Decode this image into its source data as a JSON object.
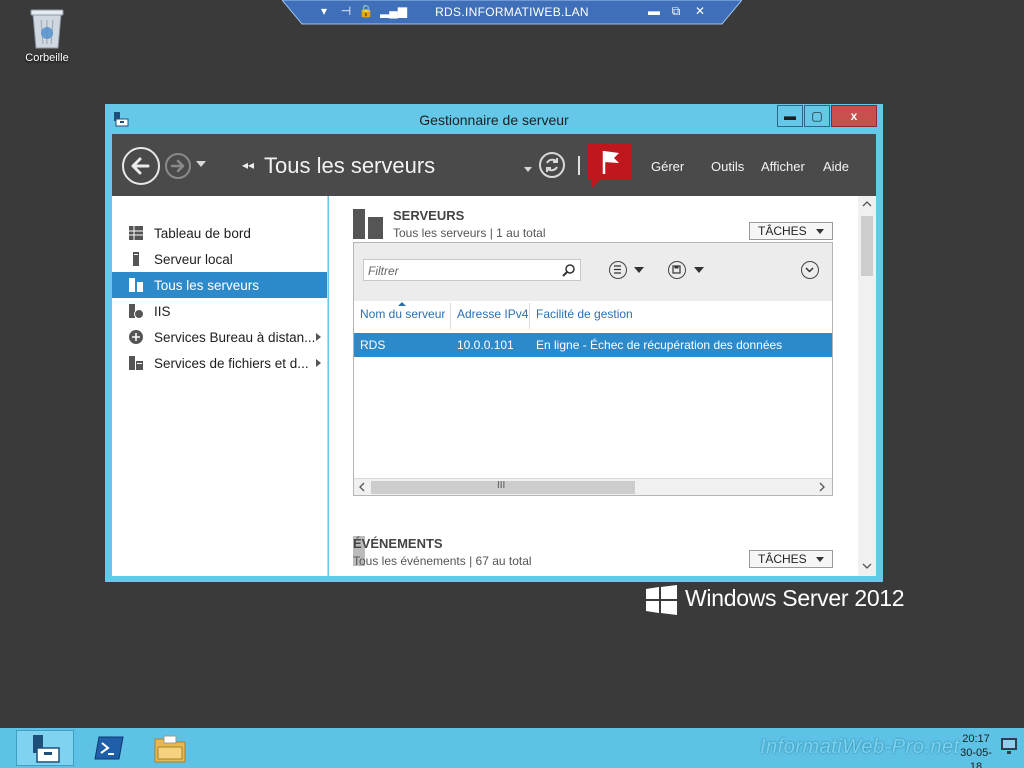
{
  "rdp_bar": {
    "title": "RDS.INFORMATIWEB.LAN"
  },
  "desktop": {
    "recycle_bin_label": "Corbeille"
  },
  "window": {
    "title": "Gestionnaire de serveur",
    "min_label": "▬",
    "max_label": "▢",
    "close_label": "x"
  },
  "toolbar": {
    "crumb_arrows": "◂◂",
    "breadcrumb": "Tous les serveurs",
    "menu": [
      "Gérer",
      "Outils",
      "Afficher",
      "Aide"
    ]
  },
  "nav": {
    "items": [
      {
        "label": "Tableau de bord",
        "icon": "dashboard-icon",
        "selected": false,
        "expandable": false
      },
      {
        "label": "Serveur local",
        "icon": "local-server-icon",
        "selected": false,
        "expandable": false
      },
      {
        "label": "Tous les serveurs",
        "icon": "all-servers-icon",
        "selected": true,
        "expandable": false
      },
      {
        "label": "IIS",
        "icon": "iis-icon",
        "selected": false,
        "expandable": false
      },
      {
        "label": "Services Bureau à distan...",
        "icon": "remote-desktop-icon",
        "selected": false,
        "expandable": true
      },
      {
        "label": "Services de fichiers et d...",
        "icon": "file-services-icon",
        "selected": false,
        "expandable": true
      }
    ]
  },
  "servers": {
    "title": "SERVEURS",
    "subtitle": "Tous les serveurs | 1 au total",
    "tasks_label": "TÂCHES",
    "filter_placeholder": "Filtrer",
    "columns": [
      "Nom du serveur",
      "Adresse IPv4",
      "Facilité de gestion"
    ],
    "rows": [
      {
        "name": "RDS",
        "ipv4": "10.0.0.101",
        "manageability": "En ligne - Échec de récupération des données"
      }
    ],
    "scroll_label": "III"
  },
  "events": {
    "title": "ÉVÉNEMENTS",
    "subtitle": "Tous les événements | 67 au total",
    "tasks_label": "TÂCHES"
  },
  "brand": {
    "text": "Windows Server 2012"
  },
  "watermark": {
    "text": "InformatiWeb-Pro.net"
  },
  "taskbar": {
    "apps": [
      "server-manager-icon",
      "powershell-icon",
      "file-explorer-icon"
    ],
    "time": "20:17",
    "date": "30-05-18"
  },
  "colors": {
    "window_frame": "#65c8e8",
    "selection": "#2c8acb",
    "toolbar": "#4a4a4a",
    "notification_flag": "#c0161d",
    "taskbar": "#5ec2e6",
    "desktop": "#3a3a3a"
  }
}
